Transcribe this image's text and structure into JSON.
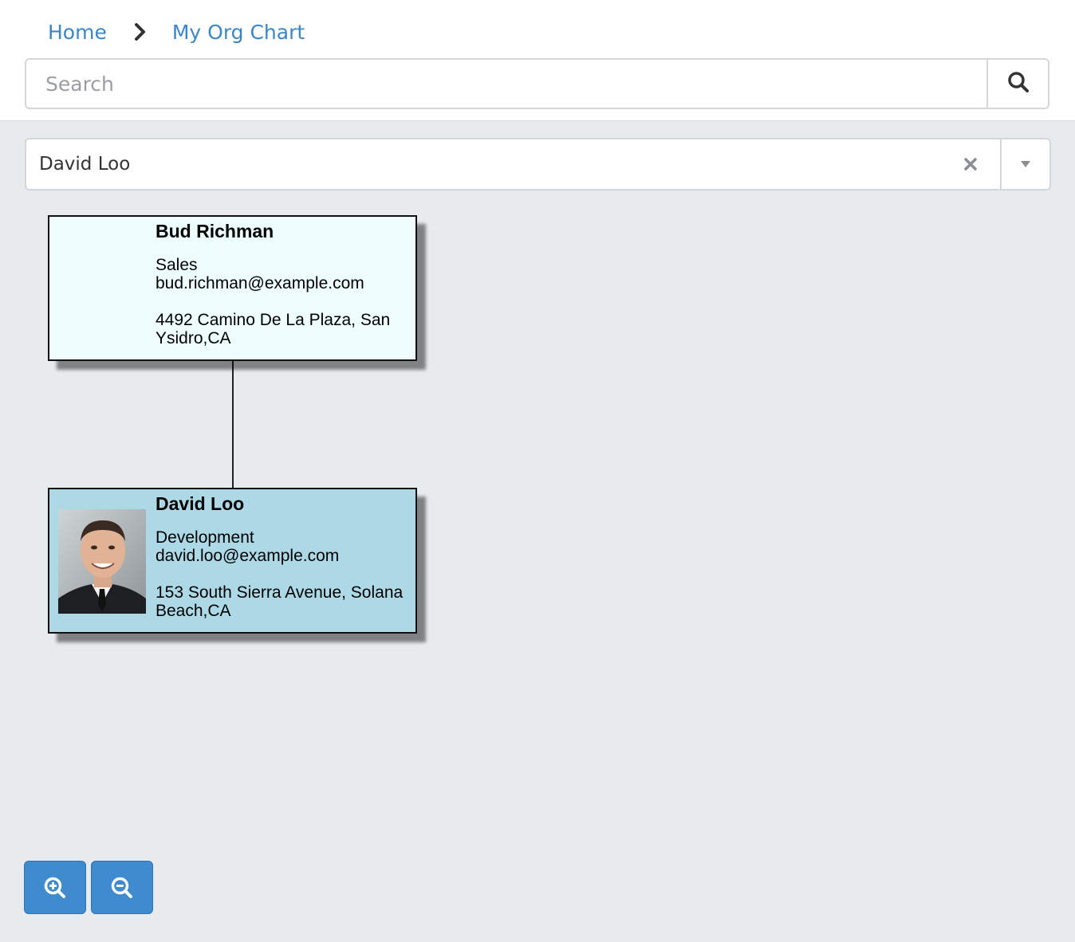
{
  "breadcrumb": {
    "home": "Home",
    "current": "My Org Chart",
    "separator_icon": "chevron-right-icon"
  },
  "search": {
    "placeholder": "Search",
    "value": "",
    "icon": "search-icon"
  },
  "employee_select": {
    "value": "David Loo",
    "clear_icon": "close-icon",
    "arrow_icon": "caret-down-icon"
  },
  "org_chart": {
    "nodes": [
      {
        "name": "Bud Richman",
        "department": "Sales",
        "email": "bud.richman@example.com",
        "address": "4492 Camino De La Plaza, San Ysidro,CA",
        "background": "#eefefe",
        "has_photo": false
      },
      {
        "name": "David Loo",
        "department": "Development",
        "email": "david.loo@example.com",
        "address": "153 South Sierra Avenue, Solana Beach,CA",
        "background": "#add8e6",
        "has_photo": true,
        "selected": true
      }
    ]
  },
  "zoom": {
    "in_icon": "zoom-in-icon",
    "out_icon": "zoom-out-icon"
  },
  "colors": {
    "link": "#3a86c6",
    "button": "#3e8bd0",
    "page_background": "#e8ebed"
  }
}
